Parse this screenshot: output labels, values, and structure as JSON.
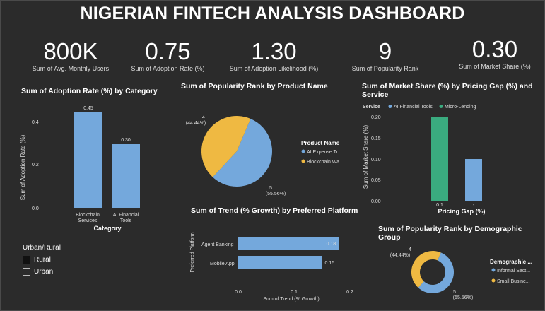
{
  "dashboard": {
    "title": "NIGERIAN FINTECH ANALYSIS DASHBOARD",
    "kpis": [
      {
        "value": "800K",
        "label": "Sum of Avg. Monthly Users"
      },
      {
        "value": "0.75",
        "label": "Sum of Adoption Rate (%)"
      },
      {
        "value": "1.30",
        "label": "Sum of Adoption Likelihood (%)"
      },
      {
        "value": "9",
        "label": "Sum of Popularity Rank"
      },
      {
        "value": "0.30",
        "label": "Sum of Market Share (%)"
      }
    ]
  },
  "colors": {
    "blue": "#74a8dc",
    "yellow": "#efb942",
    "green": "#3aab7f",
    "background": "#2b2b2b"
  },
  "slicer": {
    "title": "Urban/Rural",
    "options": [
      {
        "label": "Rural",
        "selected": true
      },
      {
        "label": "Urban",
        "selected": false
      }
    ]
  },
  "chart_data": [
    {
      "type": "bar",
      "title": "Sum of Adoption Rate (%) by Category",
      "xlabel": "Category",
      "ylabel": "Sum of Adoption Rate (%)",
      "categories": [
        "Blockchain Services",
        "AI Financial Tools"
      ],
      "category_lines": [
        [
          "Blockchain",
          "Services"
        ],
        [
          "AI Financial",
          "Tools"
        ]
      ],
      "values": [
        0.45,
        0.3
      ],
      "value_labels": [
        "0.45",
        "0.30"
      ],
      "yticks": [
        "0.4",
        "0.2",
        "0.0"
      ],
      "ylim": [
        0,
        0.5
      ]
    },
    {
      "type": "pie",
      "title": "Sum of Popularity Rank by Product Name",
      "legend_title": "Product Name",
      "slices": [
        {
          "name": "AI Expense Tr...",
          "value": 5,
          "percent": "(55.56%)"
        },
        {
          "name": "Blockchain Wa...",
          "value": 4,
          "percent": "(44.44%)"
        }
      ]
    },
    {
      "type": "bar",
      "title": "Sum of Market Share (%) by Pricing Gap (%) and Service",
      "legend_title": "Service",
      "xlabel": "Pricing Gap (%)",
      "ylabel": "Sum of Market Share (%)",
      "series": [
        {
          "name": "AI Financial Tools",
          "x": "-",
          "value": 0.1
        },
        {
          "name": "Micro-Lending",
          "x": "0.1",
          "value": 0.2
        }
      ],
      "categories": [
        "0.1",
        "-"
      ],
      "yticks": [
        "0.20",
        "0.15",
        "0.10",
        "0.05",
        "0.00"
      ],
      "ylim": [
        0,
        0.2
      ]
    },
    {
      "type": "bar",
      "orientation": "horizontal",
      "title": "Sum of Trend (% Growth) by Preferred Platform",
      "xlabel": "Sum of Trend (% Growth)",
      "ylabel": "Preferred Platform",
      "categories": [
        "Agent Banking",
        "Mobile App"
      ],
      "values": [
        0.18,
        0.15
      ],
      "value_labels": [
        "0.18",
        "0.15"
      ],
      "xticks": [
        "0.0",
        "0.1",
        "0.2"
      ],
      "xlim": [
        0,
        0.2
      ]
    },
    {
      "type": "pie",
      "variant": "donut",
      "title": "Sum of Popularity Rank by Demographic Group",
      "legend_title": "Demographic ...",
      "slices": [
        {
          "name": "Informal Sect...",
          "value": 5,
          "percent": "(55.56%)"
        },
        {
          "name": "Small Busine...",
          "value": 4,
          "percent": "(44.44%)"
        }
      ]
    }
  ]
}
